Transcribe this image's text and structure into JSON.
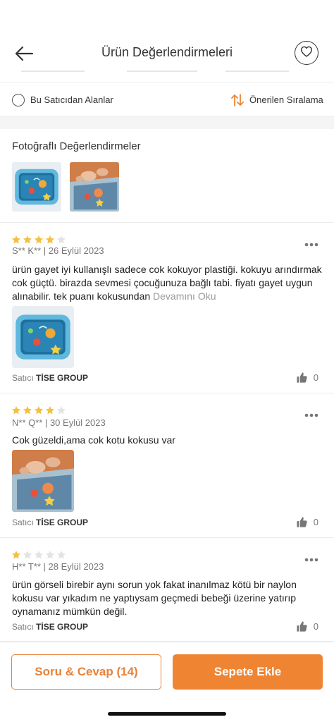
{
  "header": {
    "title": "Ürün Değerlendirmeleri",
    "back_icon": "arrow-left-icon",
    "fav_icon": "heart-icon"
  },
  "filters": {
    "seller_filter_label": "Bu Satıcıdan Alanlar",
    "sort_label": "Önerilen Sıralama",
    "sort_icon": "sort-arrows-icon"
  },
  "photo_reviews": {
    "title": "Fotoğraflı Değerlendirmeler"
  },
  "reviews": [
    {
      "rating": 4,
      "author_date": "S** K** | 26 Eylül 2023",
      "text": "ürün gayet iyi kullanışlı sadece cok kokuyor plastiği. kokuyu arındırmak cok güçtü. birazda sevmesi çocuğunuza bağlı tabi. fiyatı gayet uygun alınabilir. tek puanı kokusundan",
      "read_more": "Devamını Oku",
      "seller_prefix": "Satıcı",
      "seller_name": "TİSE GROUP",
      "likes": "0"
    },
    {
      "rating": 4,
      "author_date": "N** Q** | 30 Eylül 2023",
      "text": "Cok güzeldi,ama cok kotu kokusu var",
      "seller_prefix": "Satıcı",
      "seller_name": "TİSE GROUP",
      "likes": "0"
    },
    {
      "rating": 1,
      "author_date": "H** T** | 28 Eylül 2023",
      "text": "ürün görseli birebir aynı sorun yok fakat inanılmaz kötü bir naylon kokusu var yıkadım ne yaptıysam geçmedi bebeği üzerine yatırıp oynamanız mümkün değil.",
      "seller_prefix": "Satıcı",
      "seller_name": "TİSE GROUP",
      "likes": "0"
    }
  ],
  "actions": {
    "qa_label": "Soru & Cevap (14)",
    "cart_label": "Sepete Ekle"
  },
  "colors": {
    "accent": "#ef8533",
    "star_filled": "#f5c042",
    "star_empty": "#e3e3e3"
  }
}
